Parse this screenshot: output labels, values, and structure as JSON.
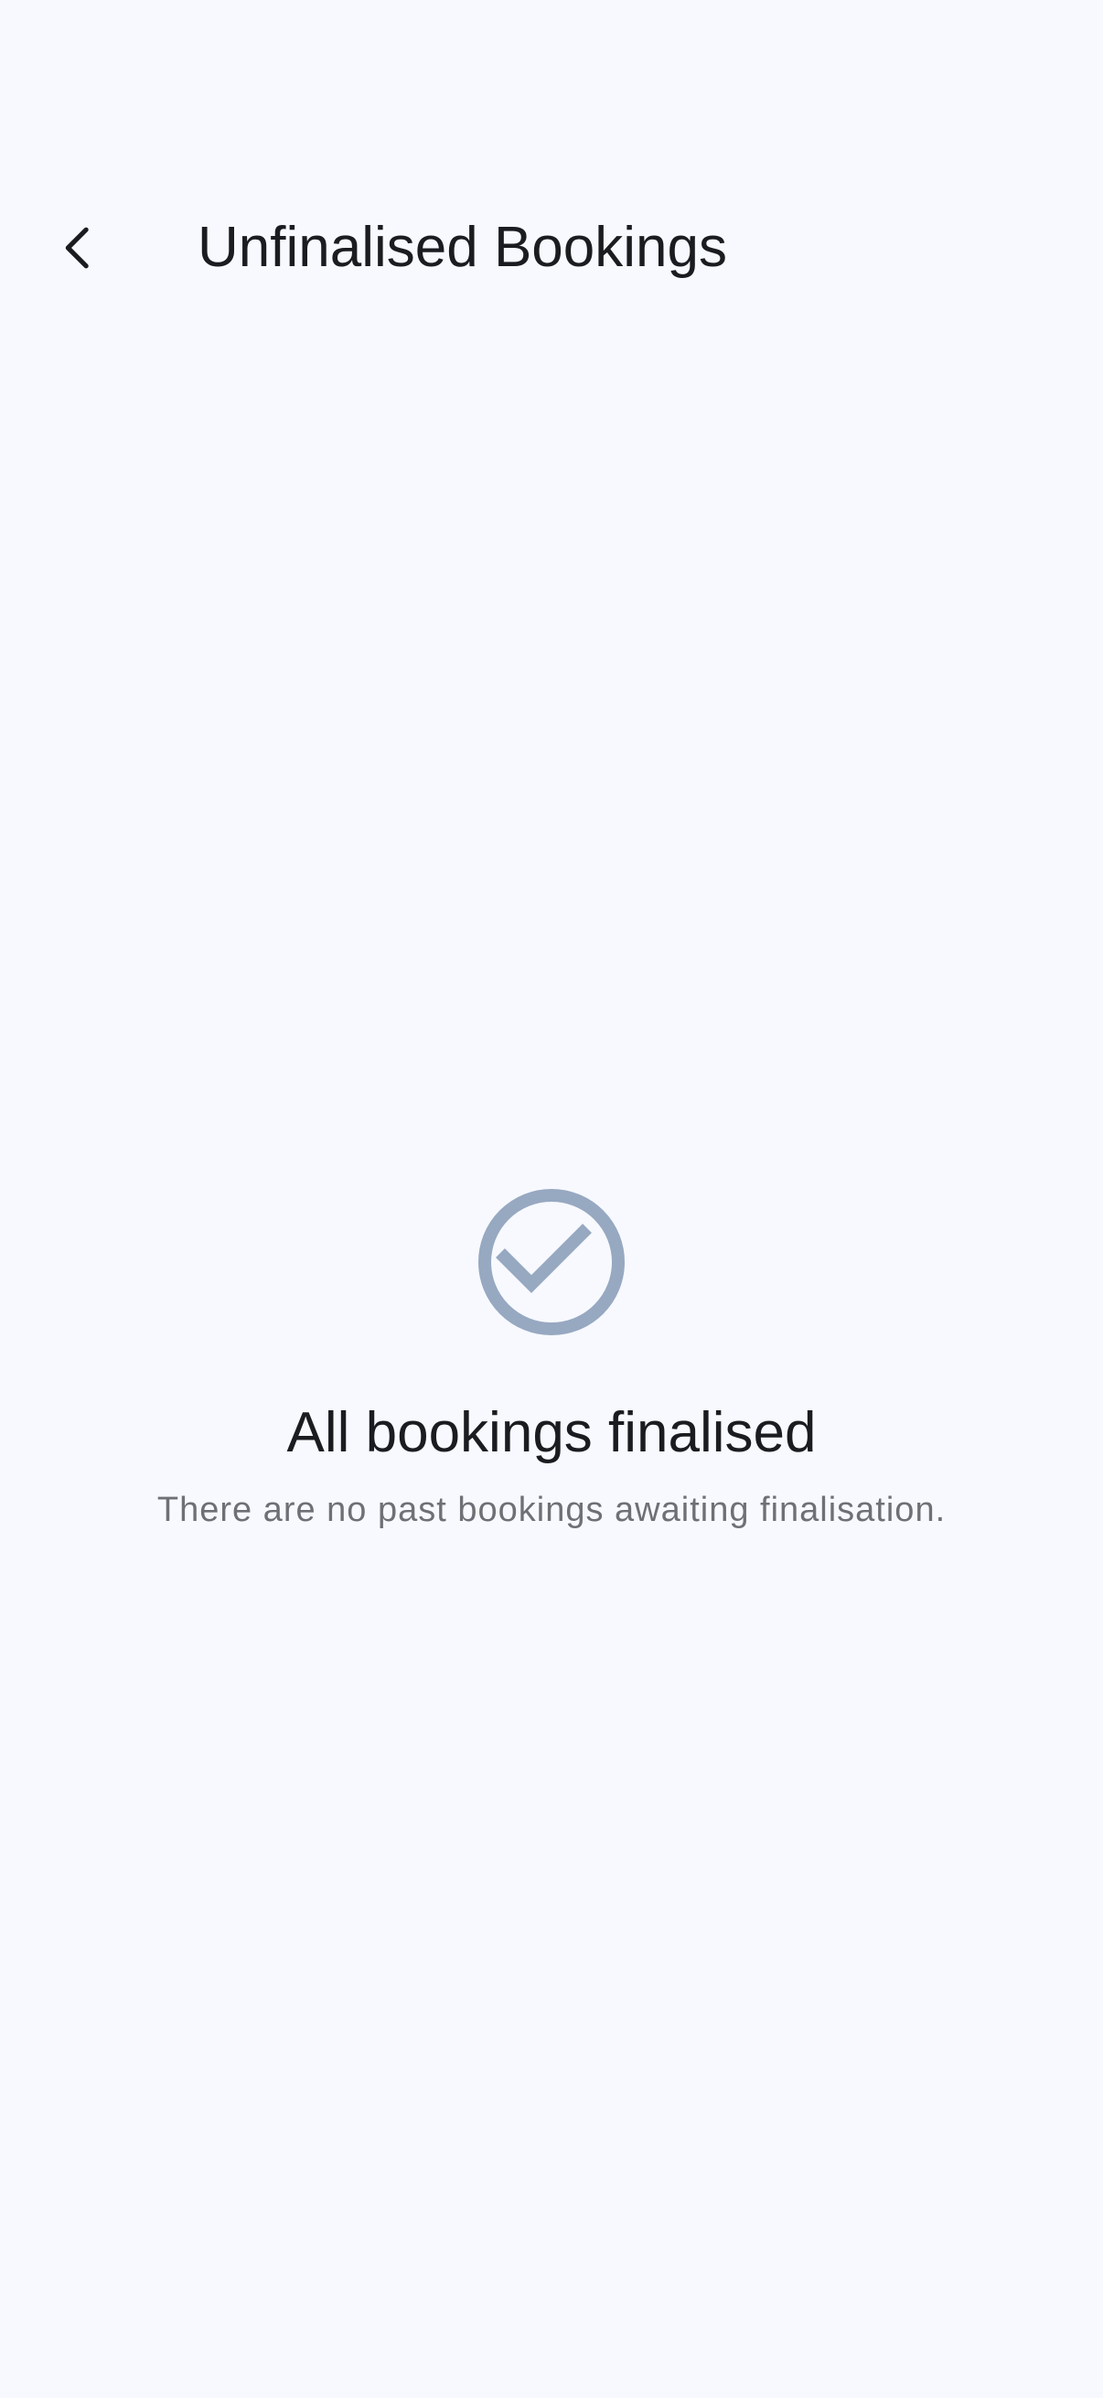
{
  "header": {
    "back_icon": "chevron-left-icon",
    "title": "Unfinalised Bookings"
  },
  "empty_state": {
    "icon": "check-circle-icon",
    "icon_color": "#97A8C1",
    "title": "All bookings finalised",
    "subtitle": "There are no past bookings awaiting finalisation."
  },
  "colors": {
    "background": "#F7F9FE",
    "text_primary": "#1B1C20",
    "text_secondary": "#6E7076"
  }
}
